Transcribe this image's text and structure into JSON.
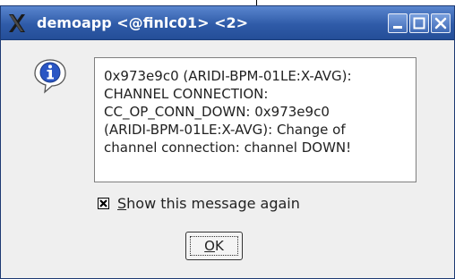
{
  "window": {
    "title": "demoapp <@finlc01> <2>",
    "icon": "x-window-icon",
    "controls": [
      "minimize-icon",
      "maximize-icon",
      "close-icon"
    ]
  },
  "dialog": {
    "icon": "info-icon",
    "message_lines": [
      "0x973e9c0 (ARIDI-BPM-01LE:X-AVG):",
      "CHANNEL CONNECTION:",
      "CC_OP_CONN_DOWN: 0x973e9c0",
      "(ARIDI-BPM-01LE:X-AVG): Change of",
      "channel connection: channel DOWN!"
    ],
    "show_again": {
      "label_mnemonic": "S",
      "label_rest": "how this message again",
      "checked": true
    },
    "ok_button": {
      "label_mnemonic": "O",
      "label_rest": "K"
    }
  },
  "colors": {
    "titlebar": "#2f5ba8",
    "dialog_bg": "#efefef",
    "message_bg": "#ffffff"
  }
}
